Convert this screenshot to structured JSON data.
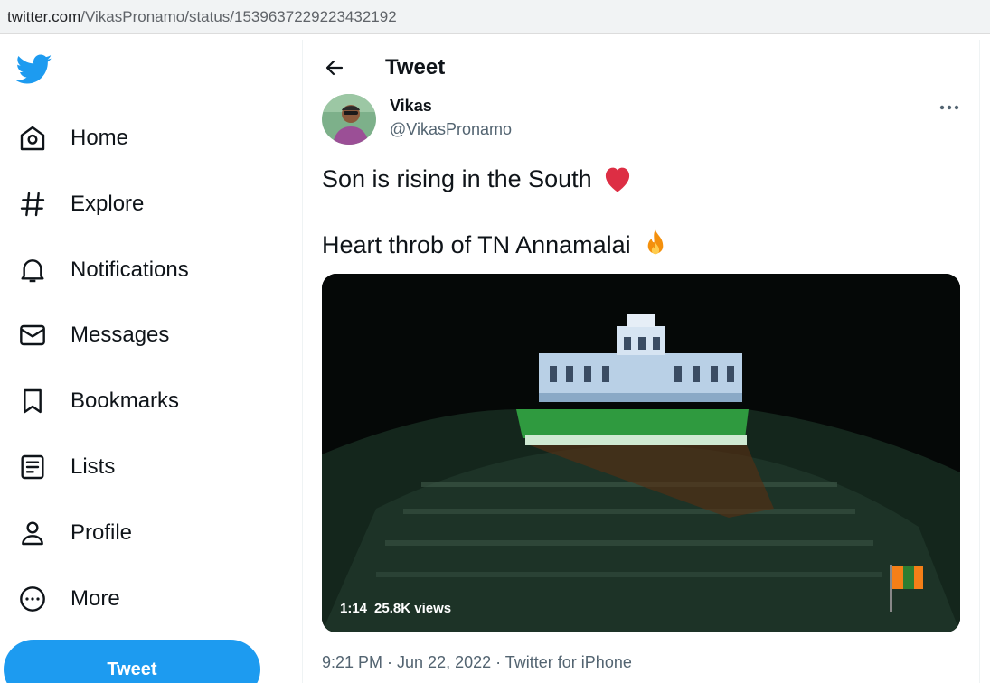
{
  "browser": {
    "url_host": "twitter.com",
    "url_path": "/VikasPronamo/status/1539637229223432192"
  },
  "sidebar": {
    "logo_icon": "twitter-bird-icon",
    "items": [
      {
        "label": "Home",
        "icon": "home-icon"
      },
      {
        "label": "Explore",
        "icon": "hashtag-icon"
      },
      {
        "label": "Notifications",
        "icon": "bell-icon"
      },
      {
        "label": "Messages",
        "icon": "envelope-icon"
      },
      {
        "label": "Bookmarks",
        "icon": "bookmark-icon"
      },
      {
        "label": "Lists",
        "icon": "list-icon"
      },
      {
        "label": "Profile",
        "icon": "person-icon"
      },
      {
        "label": "More",
        "icon": "more-circle-icon"
      }
    ],
    "tweet_button": "Tweet"
  },
  "header": {
    "title": "Tweet"
  },
  "tweet": {
    "author_name": "Vikas",
    "author_handle": "@VikasPronamo",
    "line1": "Son is rising in the South",
    "line1_emoji": "red-heart",
    "line2": "Heart throb of TN Annamalai",
    "line2_emoji": "fire",
    "video": {
      "duration": "1:14",
      "views": "25.8K views"
    },
    "timestamp": "9:21 PM · Jun 22, 2022 · Twitter for iPhone"
  },
  "colors": {
    "brand": "#1d9bf0",
    "text": "#0f1419",
    "secondary": "#536471",
    "heart": "#e0245e"
  }
}
